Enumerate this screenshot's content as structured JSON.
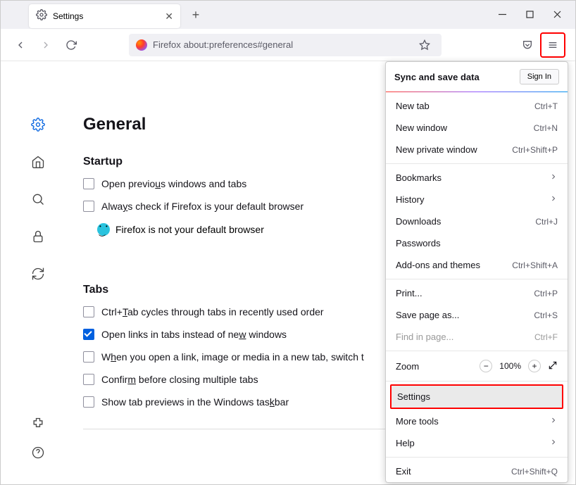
{
  "tab": {
    "title": "Settings"
  },
  "urlbar": {
    "label": "Firefox",
    "url": "about:preferences#general"
  },
  "page": {
    "heading": "General",
    "startup": {
      "title": "Startup",
      "open_previous": "Open previous windows and tabs",
      "always_check": "Always check if Firefox is your default browser",
      "status": "Firefox is not your default browser"
    },
    "tabs": {
      "title": "Tabs",
      "ctrl_tab": "Ctrl+Tab cycles through tabs in recently used order",
      "open_links": "Open links in tabs instead of new windows",
      "switch_to": "When you open a link, image or media in a new tab, switch t",
      "confirm_close": "Confirm before closing multiple tabs",
      "show_preview": "Show tab previews in the Windows taskbar"
    }
  },
  "menu": {
    "sync_title": "Sync and save data",
    "signin": "Sign In",
    "items": {
      "new_tab": "New tab",
      "new_tab_sc": "Ctrl+T",
      "new_window": "New window",
      "new_window_sc": "Ctrl+N",
      "new_private": "New private window",
      "new_private_sc": "Ctrl+Shift+P",
      "bookmarks": "Bookmarks",
      "history": "History",
      "downloads": "Downloads",
      "downloads_sc": "Ctrl+J",
      "passwords": "Passwords",
      "addons": "Add-ons and themes",
      "addons_sc": "Ctrl+Shift+A",
      "print": "Print...",
      "print_sc": "Ctrl+P",
      "save_as": "Save page as...",
      "save_as_sc": "Ctrl+S",
      "find": "Find in page...",
      "find_sc": "Ctrl+F",
      "zoom": "Zoom",
      "zoom_val": "100%",
      "settings": "Settings",
      "more_tools": "More tools",
      "help": "Help",
      "exit": "Exit",
      "exit_sc": "Ctrl+Shift+Q"
    }
  }
}
